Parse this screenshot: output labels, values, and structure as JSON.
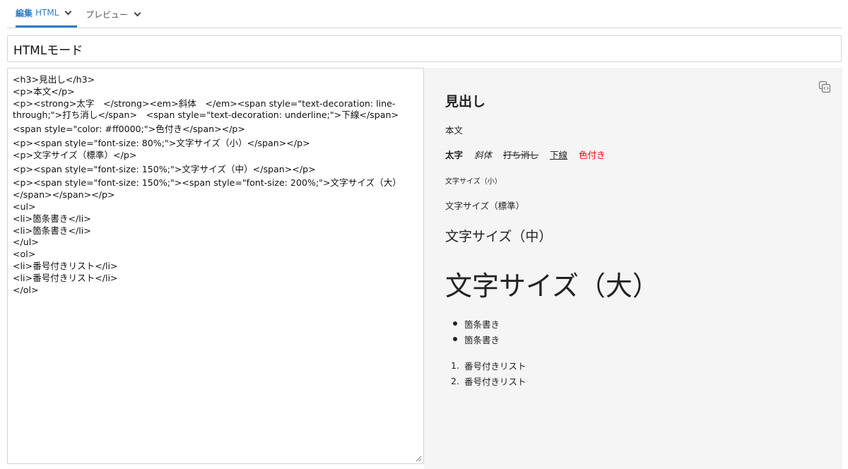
{
  "tabs": [
    {
      "strong": "編集",
      "label": "HTML",
      "active": true
    },
    {
      "strong": "",
      "label": "プレビュー",
      "active": false
    }
  ],
  "title_value": "HTMLモード",
  "editor": {
    "lines": [
      "<h3>見出し</h3>",
      "<p>本文</p>",
      "<p><strong>太字　</strong><em>斜体　</em><span style=\"text-decoration: line-",
      "through;\">打ち消し</span>　<span style=\"text-decoration: underline;\">下線</span>",
      "<span style=\"color: #ff0000;\">色付き</span></p>",
      "<p><span style=\"font-size: 80%;\">文字サイズ（小）</span></p>",
      "<p>文字サイズ（標準）</p>",
      "<p><span style=\"font-size: 150%;\">文字サイズ（中）</span></p>",
      "<p><span style=\"font-size: 150%;\"><span style=\"font-size: 200%;\">文字サイズ（大）",
      "</span></span></p>",
      "<ul>",
      "<li>箇条書き</li>",
      "<li>箇条書き</li>",
      "</ul>",
      "<ol>",
      "<li>番号付きリスト</li>",
      "<li>番号付きリスト</li>",
      "</ol>"
    ]
  },
  "preview": {
    "heading": "見出し",
    "body": "本文",
    "bold": "太字",
    "italic": "斜体",
    "strike": "打ち消し",
    "underline": "下線",
    "colored": "色付き",
    "color_red": "#ff0000",
    "size_small": "文字サイズ（小）",
    "size_normal": "文字サイズ（標準）",
    "size_mid": "文字サイズ（中）",
    "size_large": "文字サイズ（大）",
    "ul": [
      "箇条書き",
      "箇条書き"
    ],
    "ol": [
      {
        "n": "1.",
        "text": "番号付きリスト"
      },
      {
        "n": "2.",
        "text": "番号付きリスト"
      }
    ]
  },
  "colors": {
    "accent": "#2f7fc9",
    "border": "#d5d5d5",
    "preview_bg": "#f5f5f5"
  },
  "icons": {
    "tab_dropdown": "chevron-down-icon",
    "copy": "copy-code-icon",
    "resize": "resize-grip-icon"
  }
}
